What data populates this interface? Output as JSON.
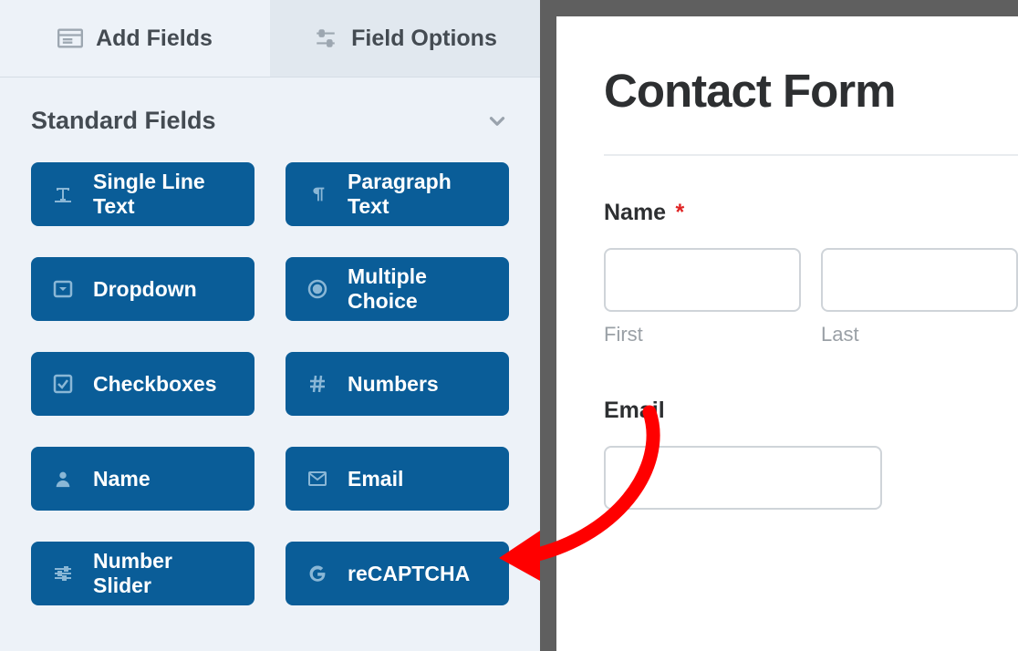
{
  "tabs": {
    "add_fields": "Add Fields",
    "field_options": "Field Options"
  },
  "section": {
    "standard_fields": "Standard Fields"
  },
  "fields": {
    "single_line_text": "Single Line Text",
    "paragraph_text": "Paragraph Text",
    "dropdown": "Dropdown",
    "multiple_choice": "Multiple Choice",
    "checkboxes": "Checkboxes",
    "numbers": "Numbers",
    "name": "Name",
    "email": "Email",
    "number_slider": "Number Slider",
    "recaptcha": "reCAPTCHA"
  },
  "preview": {
    "title": "Contact Form",
    "name_label": "Name",
    "required": "*",
    "first": "First",
    "last": "Last",
    "email_label": "Email"
  }
}
